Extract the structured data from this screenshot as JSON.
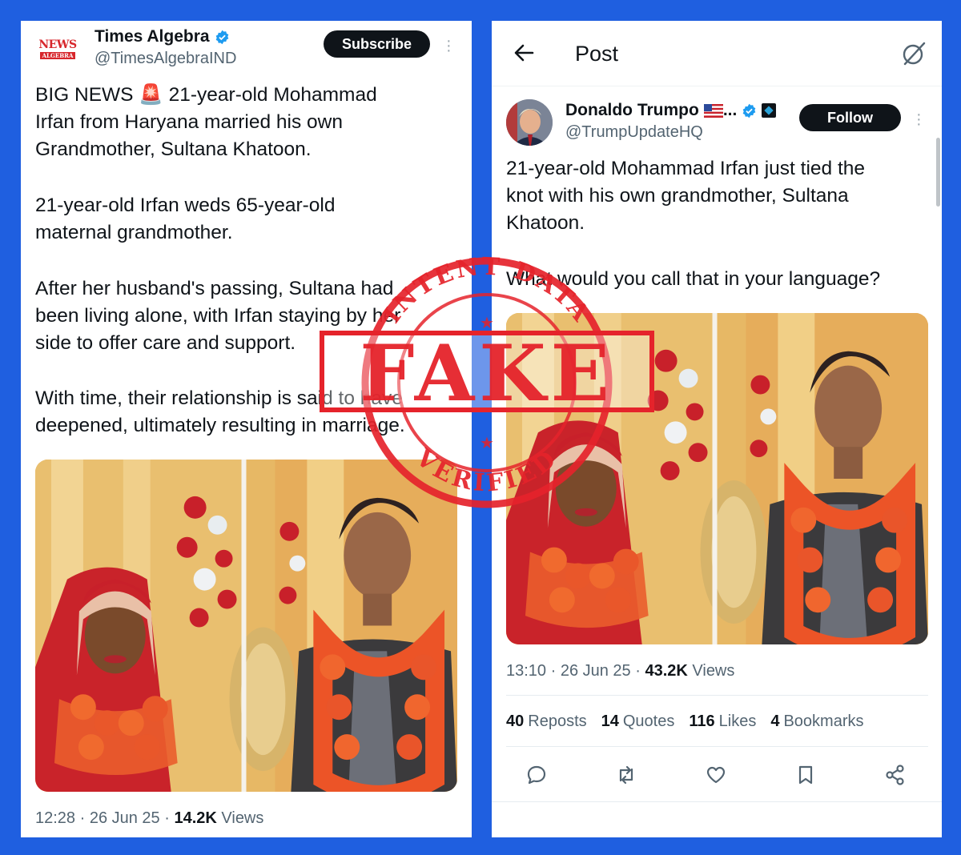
{
  "left_post": {
    "logo": {
      "top_text": "NEWS",
      "bottom_text": "ALGEBRA"
    },
    "name": "Times Algebra",
    "handle": "@TimesAlgebraIND",
    "subscribe_label": "Subscribe",
    "paragraphs": [
      "BIG NEWS 🚨 21-year-old Mohammad\nIrfan from Haryana married his own\nGrandmother, Sultana Khatoon.",
      "21-year-old Irfan weds 65-year-old\nmaternal grandmother.",
      "After her husband's passing, Sultana had\nbeen living alone, with Irfan staying by her\nside to offer care and support.",
      "With time, their relationship is said to have\ndeepened, ultimately resulting in marriage."
    ],
    "time": "12:28 · 26 Jun 25 ·",
    "views_count": "14.2K",
    "views_label": "Views"
  },
  "right_post": {
    "header_title": "Post",
    "name": "Donaldo Trumpo",
    "name_suffix": "...",
    "handle": "@TrumpUpdateHQ",
    "follow_label": "Follow",
    "paragraphs": [
      "21-year-old Mohammad Irfan just tied the\nknot with his own grandmother, Sultana\nKhatoon.",
      "What would you call that in your language?"
    ],
    "time": "13:10 · 26 Jun 25 ·",
    "views_count": "43.2K",
    "views_label": "Views",
    "stats": {
      "reposts_count": "40",
      "reposts_label": "Reposts",
      "quotes_count": "14",
      "quotes_label": "Quotes",
      "likes_count": "116",
      "likes_label": "Likes",
      "bookmarks_count": "4",
      "bookmarks_label": "Bookmarks"
    },
    "action_icons": [
      "reply-icon",
      "repost-icon",
      "like-icon",
      "bookmark-icon",
      "share-icon"
    ]
  },
  "stamp": {
    "main_text": "FAKE",
    "top_arc_text": "INTENT DATA",
    "bottom_arc_text": "VERIFIED",
    "color": "#e5232b"
  },
  "colors": {
    "background_blue": "#1f5fe0",
    "verified_blue": "#1d9bf0",
    "text_primary": "#0f1419",
    "text_secondary": "#536471"
  }
}
